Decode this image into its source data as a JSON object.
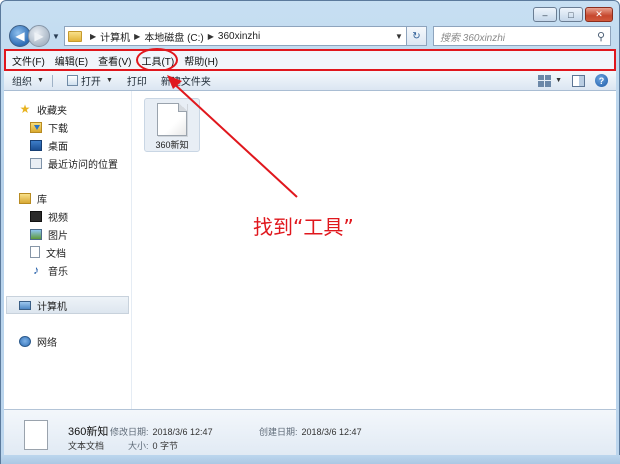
{
  "window": {
    "controls": {
      "minimize": "–",
      "maximize": "□",
      "close": "✕"
    }
  },
  "address_bar": {
    "crumbs": [
      "计算机",
      "本地磁盘 (C:)",
      "360xinzhi"
    ],
    "search_placeholder": "搜索 360xinzhi",
    "refresh": "↻",
    "search_icon": "⚲"
  },
  "menu": {
    "items": [
      "文件(F)",
      "编辑(E)",
      "查看(V)",
      "工具(T)",
      "帮助(H)"
    ]
  },
  "toolbar": {
    "organize": "组织",
    "open": "打开",
    "print": "打印",
    "new_folder": "新建文件夹",
    "help": "?"
  },
  "nav_pane": {
    "favorites": {
      "label": "收藏夹",
      "items": [
        "下载",
        "桌面",
        "最近访问的位置"
      ]
    },
    "libraries": {
      "label": "库",
      "items": [
        "视频",
        "图片",
        "文档",
        "音乐"
      ]
    },
    "computer": "计算机",
    "network": "网络"
  },
  "files": [
    {
      "name": "360新知"
    }
  ],
  "annotation": {
    "callout_text": "找到“工具”",
    "color": "#e0171d"
  },
  "details": {
    "name": "360新知",
    "type": "文本文档",
    "modified_label": "修改日期:",
    "modified_value": "2018/3/6 12:47",
    "created_label": "创建日期:",
    "created_value": "2018/3/6 12:47",
    "size_label": "大小:",
    "size_value": "0 字节"
  }
}
